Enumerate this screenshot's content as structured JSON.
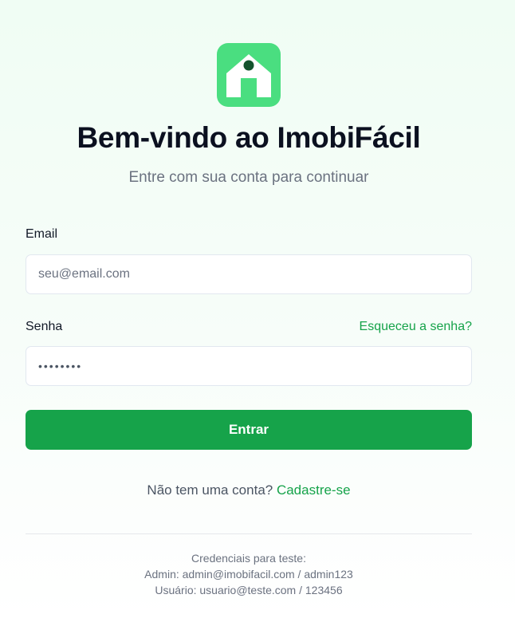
{
  "brand": {
    "accent": "#16a34a",
    "logo_bg": "#4ade80",
    "logo_icon": "home-icon"
  },
  "header": {
    "title": "Bem-vindo ao ImobiFácil",
    "subtitle": "Entre com sua conta para continuar"
  },
  "form": {
    "email_label": "Email",
    "email_placeholder": "seu@email.com",
    "email_value": "",
    "password_label": "Senha",
    "forgot_link": "Esqueceu a senha?",
    "password_masked": "••••••••",
    "submit_label": "Entrar"
  },
  "signup": {
    "prompt": "Não tem uma conta?",
    "link": "Cadastre-se"
  },
  "test_credentials": {
    "heading": "Credenciais para teste:",
    "admin": "Admin: admin@imobifacil.com / admin123",
    "user": "Usuário: usuario@teste.com / 123456"
  }
}
